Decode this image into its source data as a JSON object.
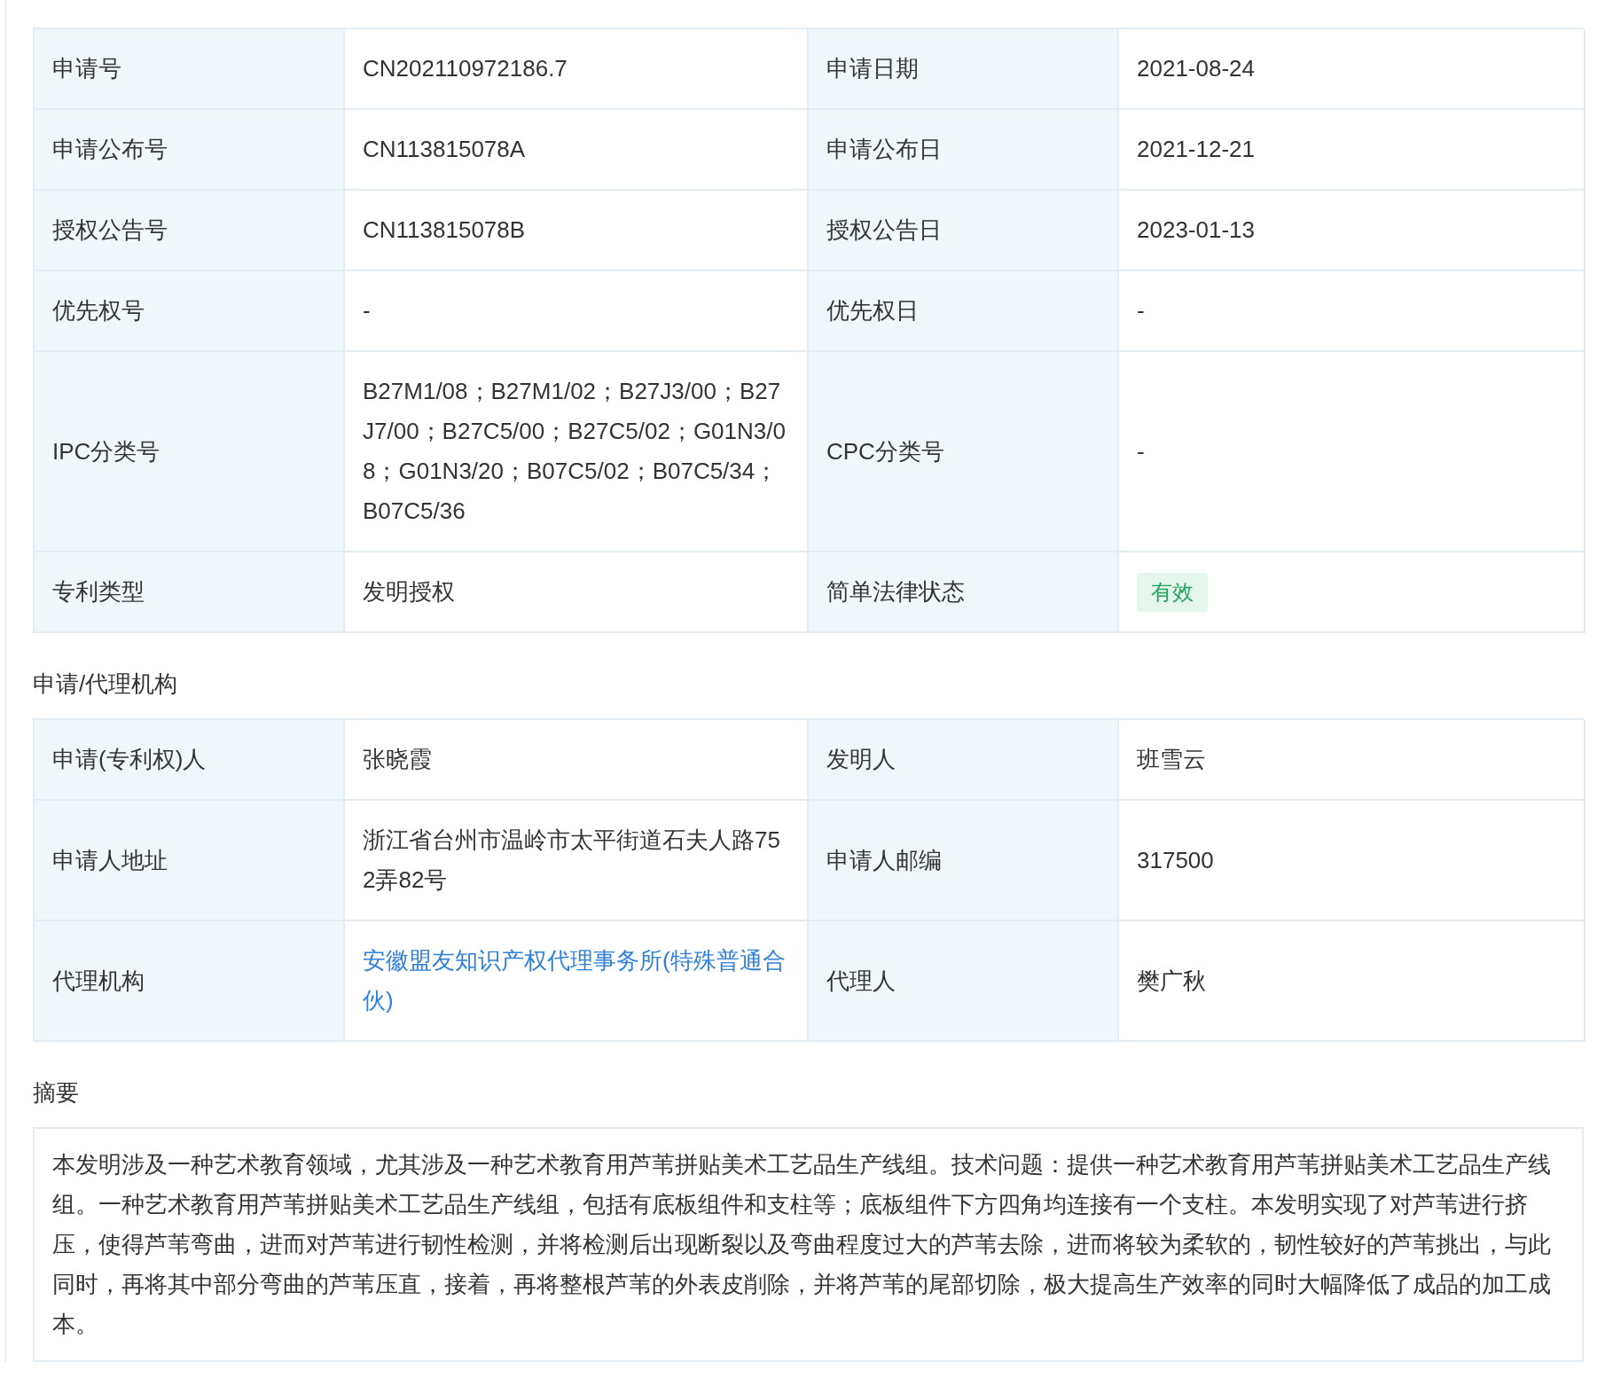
{
  "basic_info": {
    "rows": [
      [
        {
          "label": "申请号",
          "value": "CN202110972186.7",
          "kind": "text"
        },
        {
          "label": "申请日期",
          "value": "2021-08-24",
          "kind": "text"
        }
      ],
      [
        {
          "label": "申请公布号",
          "value": "CN113815078A",
          "kind": "text"
        },
        {
          "label": "申请公布日",
          "value": "2021-12-21",
          "kind": "text"
        }
      ],
      [
        {
          "label": "授权公告号",
          "value": "CN113815078B",
          "kind": "text"
        },
        {
          "label": "授权公告日",
          "value": "2023-01-13",
          "kind": "text"
        }
      ],
      [
        {
          "label": "优先权号",
          "value": "-",
          "kind": "text"
        },
        {
          "label": "优先权日",
          "value": "-",
          "kind": "text"
        }
      ],
      [
        {
          "label": "IPC分类号",
          "value": "B27M1/08；B27M1/02；B27J3/00；B27J7/00；B27C5/00；B27C5/02；G01N3/08；G01N3/20；B07C5/02；B07C5/34；B07C5/36",
          "kind": "text"
        },
        {
          "label": "CPC分类号",
          "value": "-",
          "kind": "text"
        }
      ],
      [
        {
          "label": "专利类型",
          "value": "发明授权",
          "kind": "text"
        },
        {
          "label": "简单法律状态",
          "value": "有效",
          "kind": "badge"
        }
      ]
    ]
  },
  "agency": {
    "title": "申请/代理机构",
    "rows": [
      [
        {
          "label": "申请(专利权)人",
          "value": "张晓霞",
          "kind": "text"
        },
        {
          "label": "发明人",
          "value": "班雪云",
          "kind": "text"
        }
      ],
      [
        {
          "label": "申请人地址",
          "value": "浙江省台州市温岭市太平街道石夫人路752弄82号",
          "kind": "text"
        },
        {
          "label": "申请人邮编",
          "value": "317500",
          "kind": "text"
        }
      ],
      [
        {
          "label": "代理机构",
          "value": "安徽盟友知识产权代理事务所(特殊普通合伙)",
          "kind": "link"
        },
        {
          "label": "代理人",
          "value": "樊广秋",
          "kind": "text"
        }
      ]
    ]
  },
  "abstract": {
    "title": "摘要",
    "text": "本发明涉及一种艺术教育领域，尤其涉及一种艺术教育用芦苇拼贴美术工艺品生产线组。技术问题：提供一种艺术教育用芦苇拼贴美术工艺品生产线组。一种艺术教育用芦苇拼贴美术工艺品生产线组，包括有底板组件和支柱等；底板组件下方四角均连接有一个支柱。本发明实现了对芦苇进行挤压，使得芦苇弯曲，进而对芦苇进行韧性检测，并将检测后出现断裂以及弯曲程度过大的芦苇去除，进而将较为柔软的，韧性较好的芦苇挑出，与此同时，再将其中部分弯曲的芦苇压直，接着，再将整根芦苇的外表皮削除，并将芦苇的尾部切除，极大提高生产效率的同时大幅降低了成品的加工成本。"
  }
}
